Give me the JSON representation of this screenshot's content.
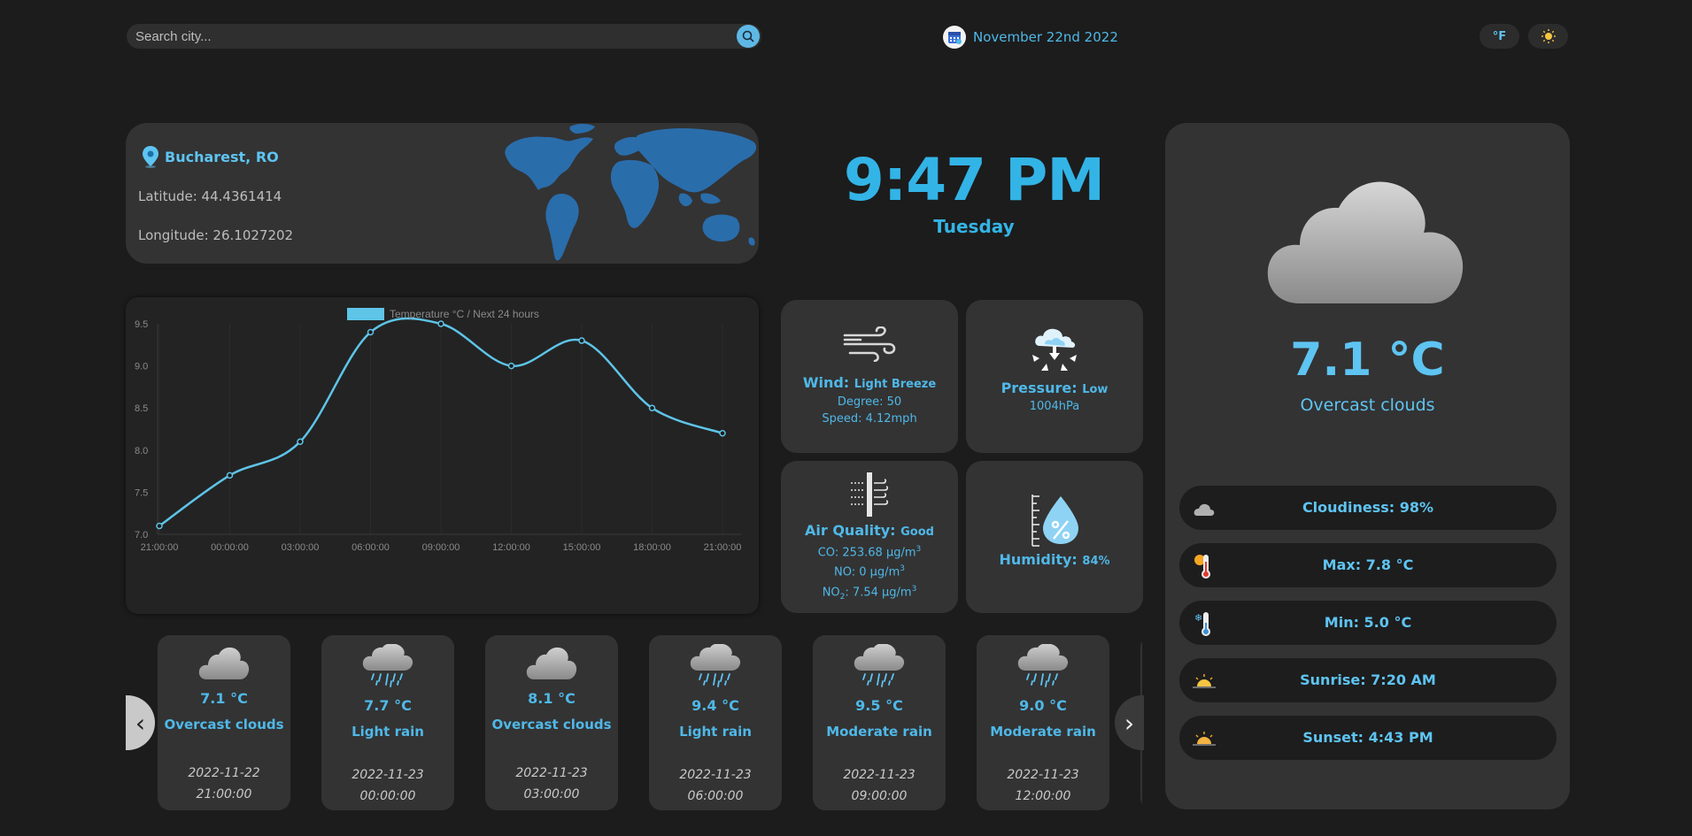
{
  "search": {
    "placeholder": "Search city..."
  },
  "header": {
    "date": "November 22nd 2022",
    "unit_button": "°F"
  },
  "location": {
    "name": "Bucharest, RO",
    "latitude": "Latitude: 44.4361414",
    "longitude": "Longitude: 26.1027202"
  },
  "clock": {
    "time": "9:47 PM",
    "weekday": "Tuesday"
  },
  "chart_data": {
    "type": "line",
    "legend": "Temperature °C / Next 24 hours",
    "x": [
      "21:00:00",
      "00:00:00",
      "03:00:00",
      "06:00:00",
      "09:00:00",
      "12:00:00",
      "15:00:00",
      "18:00:00",
      "21:00:00"
    ],
    "values": [
      7.1,
      7.7,
      8.1,
      9.4,
      9.5,
      9.0,
      9.3,
      8.5,
      8.2
    ],
    "ylim": [
      7.0,
      9.5
    ],
    "yticks": [
      "9.5",
      "9.0",
      "8.5",
      "8.0",
      "7.5",
      "7.0"
    ],
    "grid": true,
    "line_color": "#5ec4e8"
  },
  "tiles": {
    "wind": {
      "label": "Wind:",
      "value": "Light Breeze",
      "degree": "Degree: 50",
      "speed": "Speed: 4.12mph"
    },
    "pressure": {
      "label": "Pressure:",
      "value": "Low",
      "reading": "1004hPa"
    },
    "air": {
      "label": "Air Quality:",
      "value": "Good",
      "co": "CO: 253.68 μg/m",
      "no": "NO: 0 μg/m",
      "no2_prefix": "NO",
      "no2_value": ": 7.54 μg/m",
      "sup": "3",
      "sub": "2"
    },
    "humidity": {
      "label": "Humidity:",
      "value": "84%"
    }
  },
  "current": {
    "temp": "7.1 °C",
    "desc": "Overcast clouds",
    "details": [
      {
        "icon": "cloud-icon",
        "text": "Cloudiness: 98%"
      },
      {
        "icon": "thermometer-hot-icon",
        "text": "Max: 7.8 °C"
      },
      {
        "icon": "thermometer-cold-icon",
        "text": "Min: 5.0 °C"
      },
      {
        "icon": "sunrise-icon",
        "text": "Sunrise: 7:20 AM"
      },
      {
        "icon": "sunset-icon",
        "text": "Sunset: 4:43 PM"
      }
    ]
  },
  "forecast": [
    {
      "icon": "cloud-icon",
      "temp": "7.1 °C",
      "desc": "Overcast clouds",
      "date": "2022-11-22",
      "time": "21:00:00"
    },
    {
      "icon": "rain-icon",
      "temp": "7.7 °C",
      "desc": "Light rain",
      "date": "2022-11-23",
      "time": "00:00:00"
    },
    {
      "icon": "cloud-icon",
      "temp": "8.1 °C",
      "desc": "Overcast clouds",
      "date": "2022-11-23",
      "time": "03:00:00"
    },
    {
      "icon": "rain-icon",
      "temp": "9.4 °C",
      "desc": "Light rain",
      "date": "2022-11-23",
      "time": "06:00:00"
    },
    {
      "icon": "rain-icon",
      "temp": "9.5 °C",
      "desc": "Moderate rain",
      "date": "2022-11-23",
      "time": "09:00:00"
    },
    {
      "icon": "rain-icon",
      "temp": "9.0 °C",
      "desc": "Moderate rain",
      "date": "2022-11-23",
      "time": "12:00:00"
    }
  ],
  "nav": {
    "prev": "‹",
    "next": "›"
  }
}
